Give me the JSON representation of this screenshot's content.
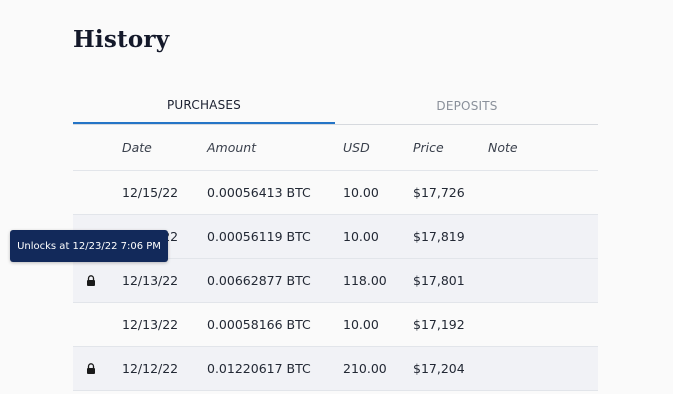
{
  "page": {
    "title": "History"
  },
  "tabs": [
    {
      "label": "PURCHASES",
      "active": true
    },
    {
      "label": "DEPOSITS",
      "active": false
    }
  ],
  "table": {
    "columns": [
      "Date",
      "Amount",
      "USD",
      "Price",
      "Note"
    ],
    "rows": [
      {
        "locked": false,
        "date": "12/15/22",
        "amount": "0.00056413 BTC",
        "usd": "10.00",
        "price": "$17,726",
        "note": ""
      },
      {
        "locked": true,
        "date": "12/14/22",
        "amount": "0.00056119 BTC",
        "usd": "10.00",
        "price": "$17,819",
        "note": ""
      },
      {
        "locked": true,
        "date": "12/13/22",
        "amount": "0.00662877 BTC",
        "usd": "118.00",
        "price": "$17,801",
        "note": ""
      },
      {
        "locked": false,
        "date": "12/13/22",
        "amount": "0.00058166 BTC",
        "usd": "10.00",
        "price": "$17,192",
        "note": ""
      },
      {
        "locked": true,
        "date": "12/12/22",
        "amount": "0.01220617 BTC",
        "usd": "210.00",
        "price": "$17,204",
        "note": ""
      }
    ]
  },
  "tooltip": {
    "text": "Unlocks at 12/23/22 7:06 PM"
  },
  "colors": {
    "accent": "#2474c6",
    "tooltip_bg": "#12295a",
    "row_shade": "#f1f2f6"
  },
  "icons": {
    "lock": "lock-icon"
  }
}
